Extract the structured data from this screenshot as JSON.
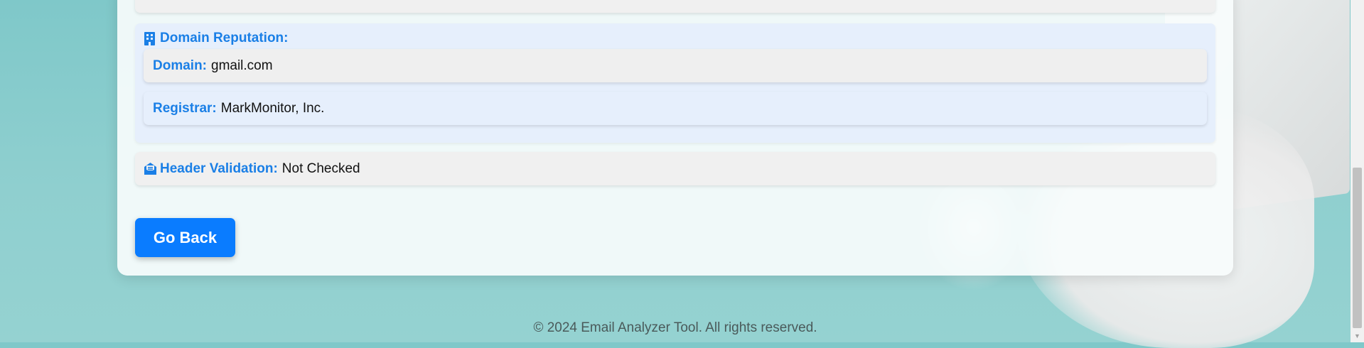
{
  "domain_reputation": {
    "title": "Domain Reputation:",
    "domain_label": "Domain:",
    "domain_value": "gmail.com",
    "registrar_label": "Registrar:",
    "registrar_value": "MarkMonitor, Inc."
  },
  "header_validation": {
    "label": "Header Validation:",
    "value": "Not Checked"
  },
  "actions": {
    "go_back_label": "Go Back"
  },
  "footer": {
    "text": "© 2024 Email Analyzer Tool. All rights reserved."
  },
  "icons": {
    "domain_section": "building-icon",
    "header_section": "envelope-open-icon"
  },
  "colors": {
    "accent": "#1a7fe6",
    "button": "#0a7cff",
    "section_bg": "#e6effc",
    "item_bg": "#f0f0f0"
  }
}
